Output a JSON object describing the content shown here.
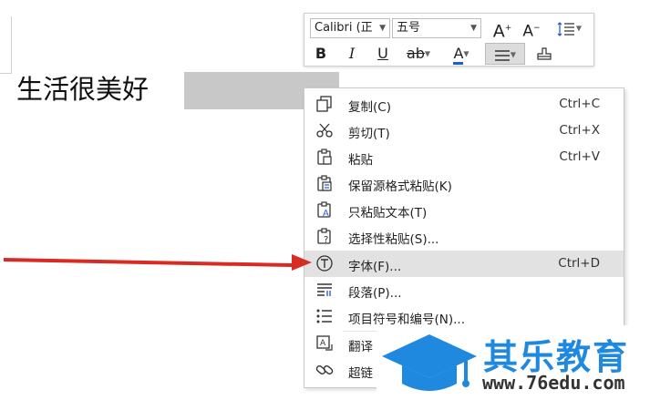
{
  "document": {
    "text": "生活很美好"
  },
  "toolbar": {
    "font_name": "Calibri (正",
    "font_size": "五号",
    "grow_label": "A",
    "shrink_label": "A",
    "bold_label": "B",
    "italic_label": "I",
    "underline_label": "U",
    "strike_label": "ab",
    "color_label": "A",
    "colors": {
      "font_color_underline": "#1a5fd0"
    }
  },
  "menu": {
    "items": [
      {
        "label": "复制(C)",
        "shortcut": "Ctrl+C",
        "icon": "copy-icon"
      },
      {
        "label": "剪切(T)",
        "shortcut": "Ctrl+X",
        "icon": "scissors-icon"
      },
      {
        "label": "粘贴",
        "shortcut": "Ctrl+V",
        "icon": "paste-icon"
      },
      {
        "label": "保留源格式粘贴(K)",
        "shortcut": "",
        "icon": "paste-keep-format-icon"
      },
      {
        "label": "只粘贴文本(T)",
        "shortcut": "",
        "icon": "paste-text-only-icon"
      },
      {
        "label": "选择性粘贴(S)...",
        "shortcut": "",
        "icon": "paste-special-icon"
      },
      {
        "label": "字体(F)...",
        "shortcut": "Ctrl+D",
        "icon": "font-icon",
        "highlighted": true
      },
      {
        "label": "段落(P)...",
        "shortcut": "",
        "icon": "paragraph-icon"
      },
      {
        "label": "项目符号和编号(N)...",
        "shortcut": "",
        "icon": "bullets-icon"
      },
      {
        "label": "翻译",
        "shortcut": "",
        "icon": "translate-icon"
      },
      {
        "label": "超链",
        "shortcut": "",
        "icon": "hyperlink-icon"
      }
    ]
  },
  "watermark": {
    "title": "其乐教育",
    "url": "www.76edu.com",
    "colors": {
      "brand": "#1f89e0"
    }
  },
  "annotation": {
    "arrow_color": "#d92b23"
  }
}
